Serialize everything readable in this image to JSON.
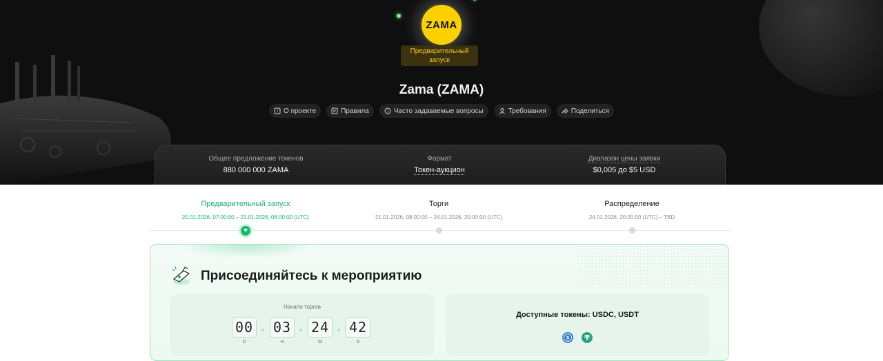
{
  "hero": {
    "logo_text": "ZAMA",
    "status_badge": "Предварительный запуск",
    "title": "Zama (ZAMA)",
    "tabs": [
      {
        "label": "О проекте",
        "icon": "question-icon"
      },
      {
        "label": "Правила",
        "icon": "rules-icon"
      },
      {
        "label": "Часто задаваемые вопросы",
        "icon": "faq-icon"
      },
      {
        "label": "Требования",
        "icon": "user-icon"
      },
      {
        "label": "Поделиться",
        "icon": "share-icon"
      }
    ]
  },
  "stats": {
    "supply_label": "Общее предложение токенов",
    "supply_value": "880 000 000 ZAMA",
    "format_label": "Формат",
    "format_value": "Токен-аукцион",
    "price_label": "Диапазон цены заявки",
    "price_value": "$0,005 до $5 USD"
  },
  "timeline": {
    "phases": [
      {
        "name": "Предварительный запуск",
        "date": "20.01.2026, 07:00:00 – 21.01.2026, 08:00:00 (UTC)",
        "active": true
      },
      {
        "name": "Торги",
        "date": "21.01.2026, 08:00:00 – 24.01.2026, 20:00:00 (UTC)",
        "active": false
      },
      {
        "name": "Распределение",
        "date": "24.01.2026, 20:00:00 (UTC) – TBD",
        "active": false
      }
    ]
  },
  "event_card": {
    "title": "Присоединяйтесь к мероприятию",
    "countdown_label": "Начало торгов",
    "countdown": [
      {
        "value": "00",
        "unit": "D"
      },
      {
        "value": "03",
        "unit": "H"
      },
      {
        "value": "24",
        "unit": "M"
      },
      {
        "value": "42",
        "unit": "S"
      }
    ],
    "tokens_label": "Доступные токены: USDC, USDT",
    "tokens": [
      {
        "name": "usdc-icon",
        "color": "#2775ca"
      },
      {
        "name": "usdt-icon",
        "color": "#26a17b"
      }
    ]
  },
  "colors": {
    "accent": "#16b86c",
    "badge_bg": "#3b3210",
    "badge_text": "#f5c51a",
    "logo_yellow": "#fdd000"
  }
}
